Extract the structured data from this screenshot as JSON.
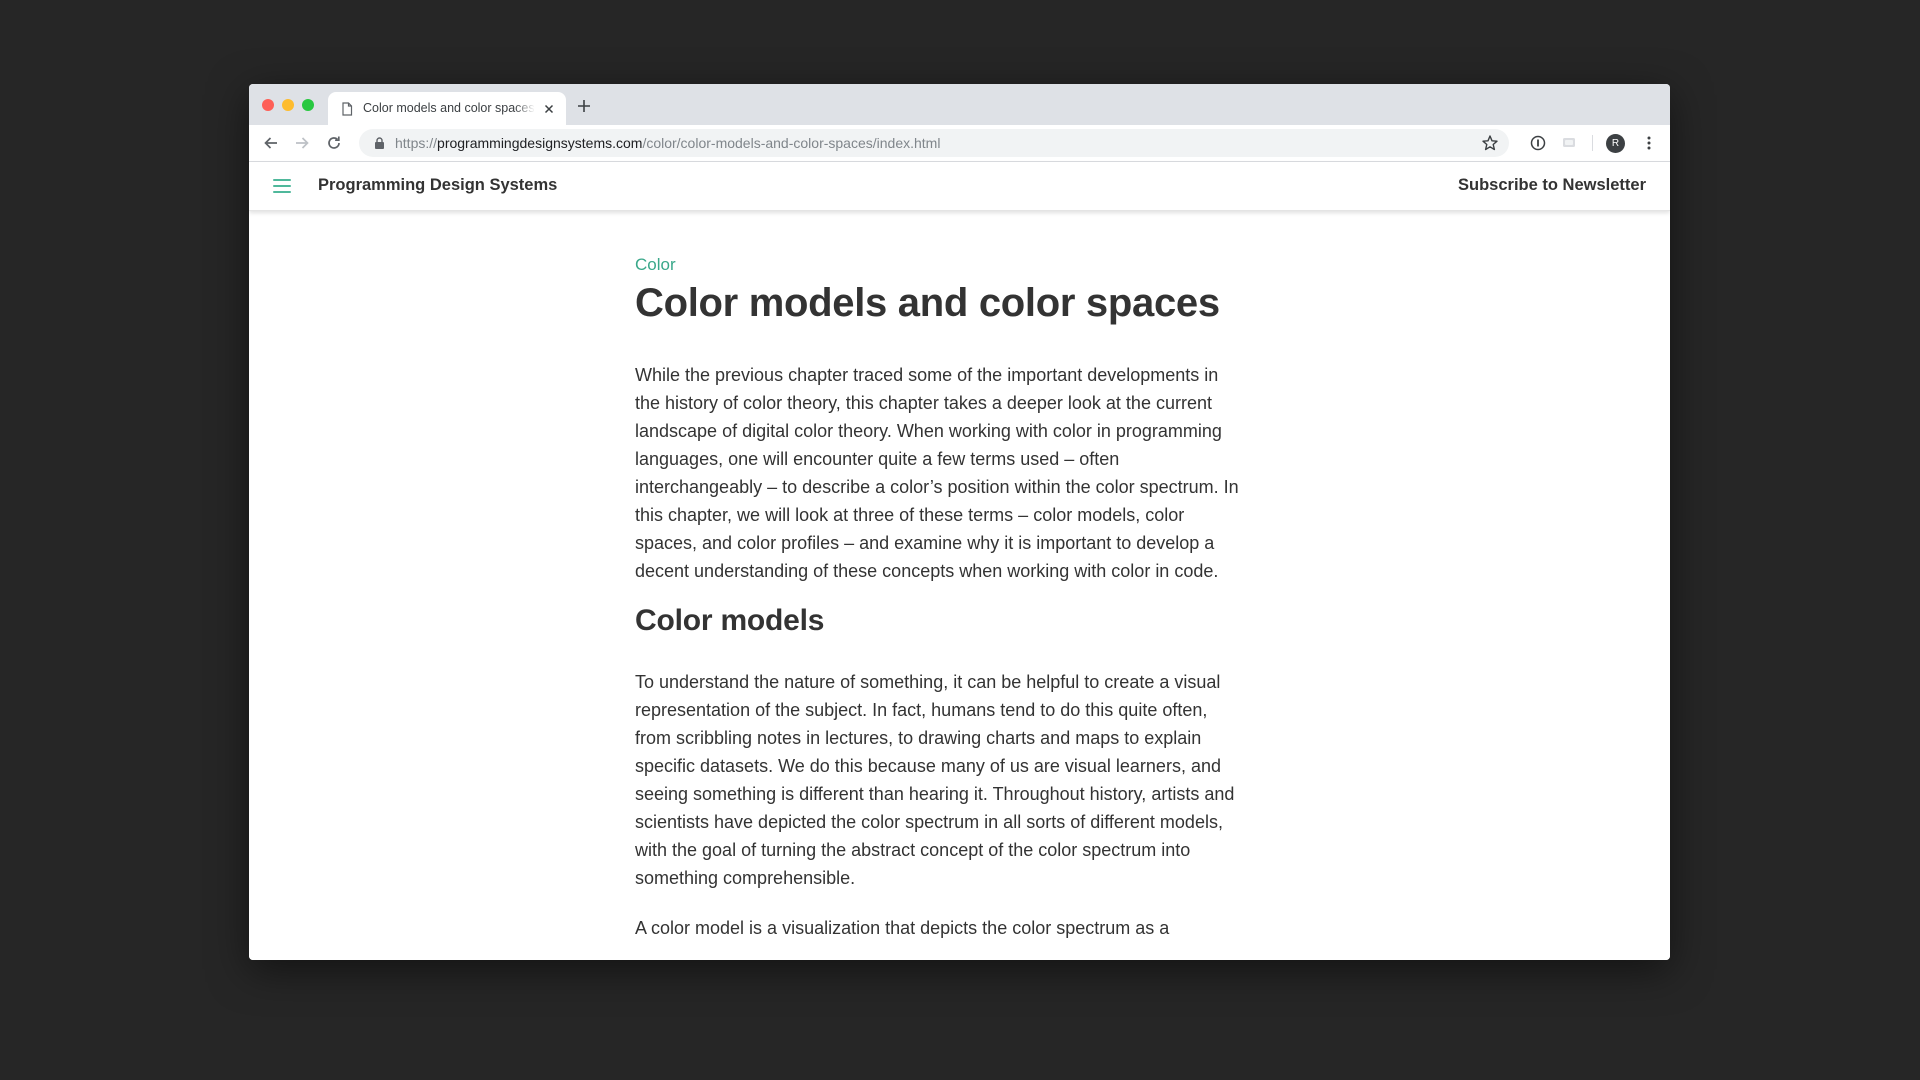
{
  "browser": {
    "tab_title": "Color models and color spaces",
    "url_scheme": "https://",
    "url_host": "programmingdesignsystems.com",
    "url_path": "/color/color-models-and-color-spaces/index.html",
    "profile_initial": "R",
    "icons": [
      "file-icon",
      "close-icon",
      "plus-icon",
      "back-arrow-icon",
      "forward-arrow-icon",
      "reload-icon",
      "lock-icon",
      "star-icon",
      "info-icon",
      "cast-icon",
      "more-vert-icon"
    ]
  },
  "site": {
    "title": "Programming Design Systems",
    "subscribe": "Subscribe to Newsletter",
    "accent_color": "#3aa88a"
  },
  "article": {
    "category": "Color",
    "title": "Color models and color spaces",
    "intro_lines": [
      "While the previous chapter traced some of the important developments in",
      "the history of color theory, this chapter takes a deeper look at the current",
      "landscape of digital color theory. When working with color in programming",
      "languages, one will encounter quite a few terms used – often",
      "interchangeably – to describe a color’s position within the color spectrum. In",
      "this chapter, we will look at three of these terms – color models, color",
      "spaces, and color profiles – and examine why it is important to develop a",
      "decent understanding of these concepts when working with color in code."
    ],
    "section_heading": "Color models",
    "section_lines": [
      "To understand the nature of something, it can be helpful to create a visual",
      "representation of the subject. In fact, humans tend to do this quite often,",
      "from scribbling notes in lectures, to drawing charts and maps to explain",
      "specific datasets. We do this because many of us are visual learners, and",
      "seeing something is different than hearing it. Throughout history, artists and",
      "scientists have depicted the color spectrum in all sorts of different models,",
      "with the goal of turning the abstract concept of the color spectrum into",
      "something comprehensible."
    ],
    "last_lines": [
      "A color model is a visualization that depicts the color spectrum as a"
    ]
  }
}
